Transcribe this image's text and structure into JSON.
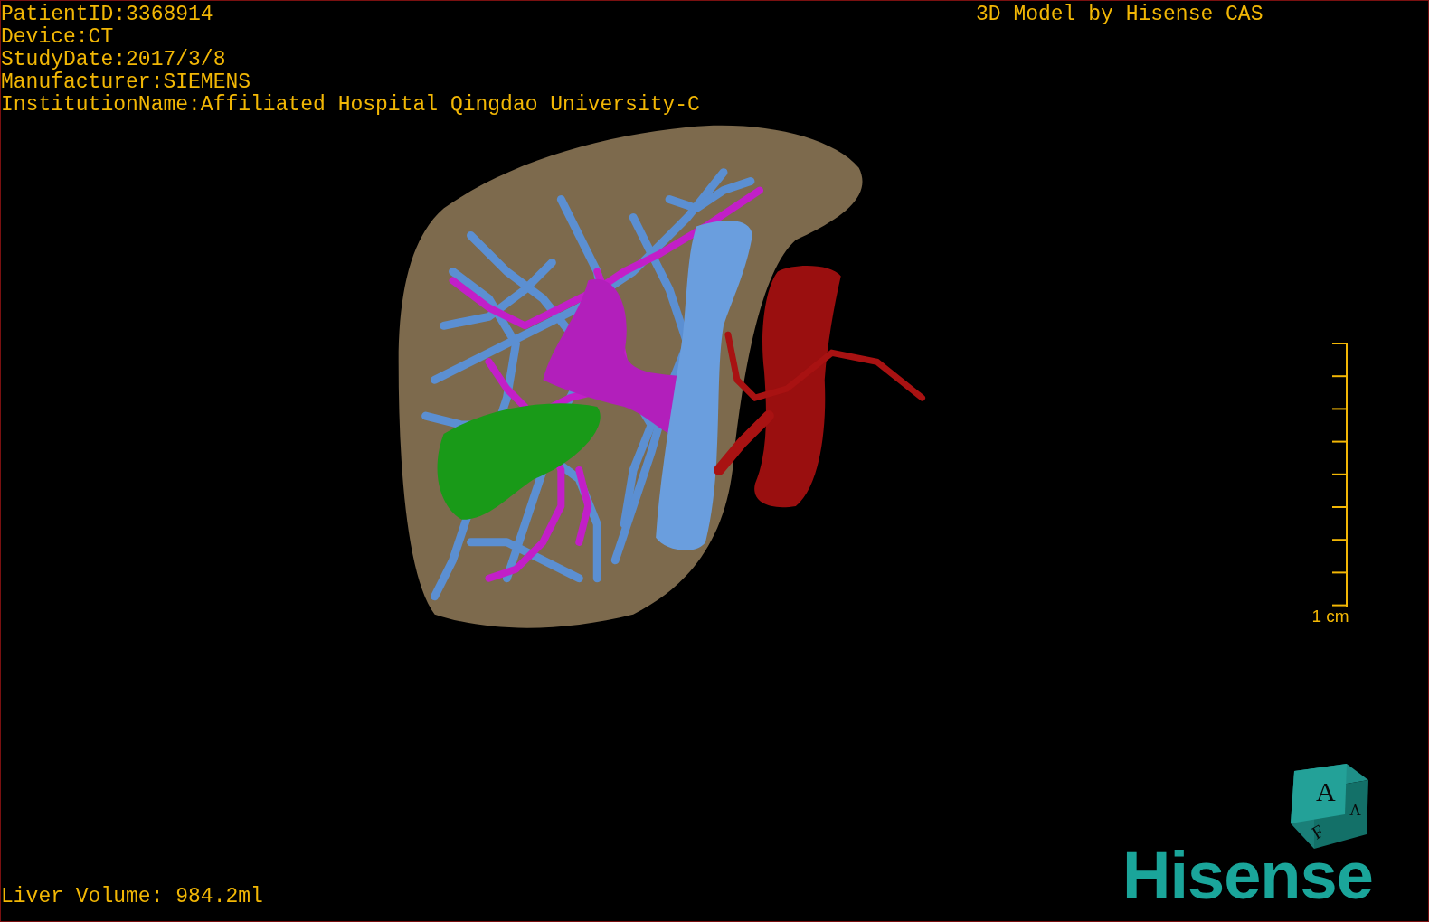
{
  "info_lines": [
    "PatientID:3368914",
    "Device:CT",
    "StudyDate:2017/3/8",
    "Manufacturer:SIEMENS",
    "InstitutionName:Affiliated Hospital Qingdao University-C"
  ],
  "title": "3D Model by Hisense CAS",
  "scale_bar": {
    "label": "1 cm"
  },
  "orientation_cube": {
    "faces": [
      "A",
      "F",
      "V"
    ]
  },
  "logo": "Hisense",
  "liver_volume": "Liver Volume: 984.2ml"
}
